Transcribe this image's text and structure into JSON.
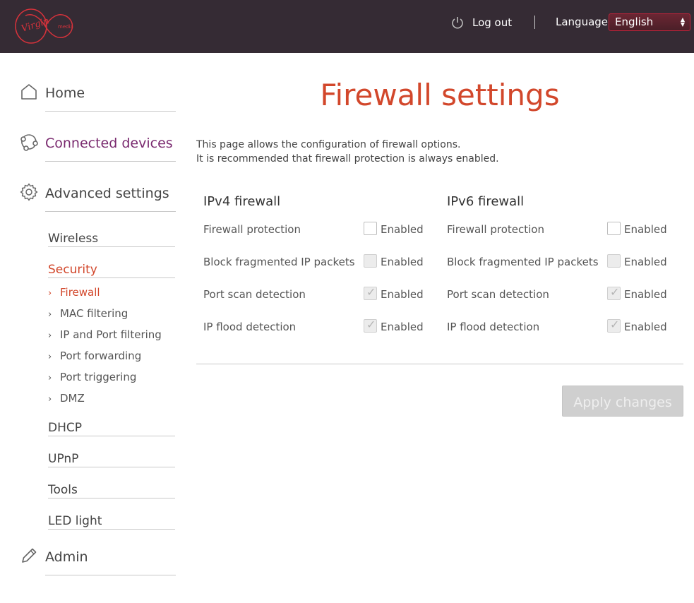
{
  "header": {
    "brand": "Virgin media",
    "logout_label": "Log out",
    "language_label": "Language",
    "language_value": "English"
  },
  "sidebar": {
    "home": "Home",
    "connected_devices": "Connected devices",
    "advanced_settings": "Advanced settings",
    "sub": {
      "wireless": "Wireless",
      "security": "Security",
      "dhcp": "DHCP",
      "upnp": "UPnP",
      "tools": "Tools",
      "led": "LED light"
    },
    "security_items": [
      "Firewall",
      "MAC filtering",
      "IP and Port filtering",
      "Port forwarding",
      "Port triggering",
      "DMZ"
    ],
    "admin": "Admin"
  },
  "main": {
    "title": "Firewall settings",
    "intro_line1": "This page allows the configuration of firewall options.",
    "intro_line2": "It is recommended that firewall protection is always enabled.",
    "ipv4": {
      "heading": "IPv4 firewall",
      "rows": [
        {
          "label": "Firewall protection",
          "checkbox": "Enabled",
          "checked": false
        },
        {
          "label": "Block fragmented IP packets",
          "checkbox": "Enabled",
          "checked": false
        },
        {
          "label": "Port scan detection",
          "checkbox": "Enabled",
          "checked": true
        },
        {
          "label": "IP flood detection",
          "checkbox": "Enabled",
          "checked": true
        }
      ]
    },
    "ipv6": {
      "heading": "IPv6 firewall",
      "rows": [
        {
          "label": "Firewall protection",
          "checkbox": "Enabled",
          "checked": false
        },
        {
          "label": "Block fragmented IP packets",
          "checkbox": "Enabled",
          "checked": false
        },
        {
          "label": "Port scan detection",
          "checkbox": "Enabled",
          "checked": true
        },
        {
          "label": "IP flood detection",
          "checkbox": "Enabled",
          "checked": true
        }
      ]
    },
    "apply_label": "Apply changes"
  },
  "colors": {
    "header_bg": "#352b34",
    "accent_red": "#d2472b",
    "accent_purple": "#7a2a6f"
  }
}
